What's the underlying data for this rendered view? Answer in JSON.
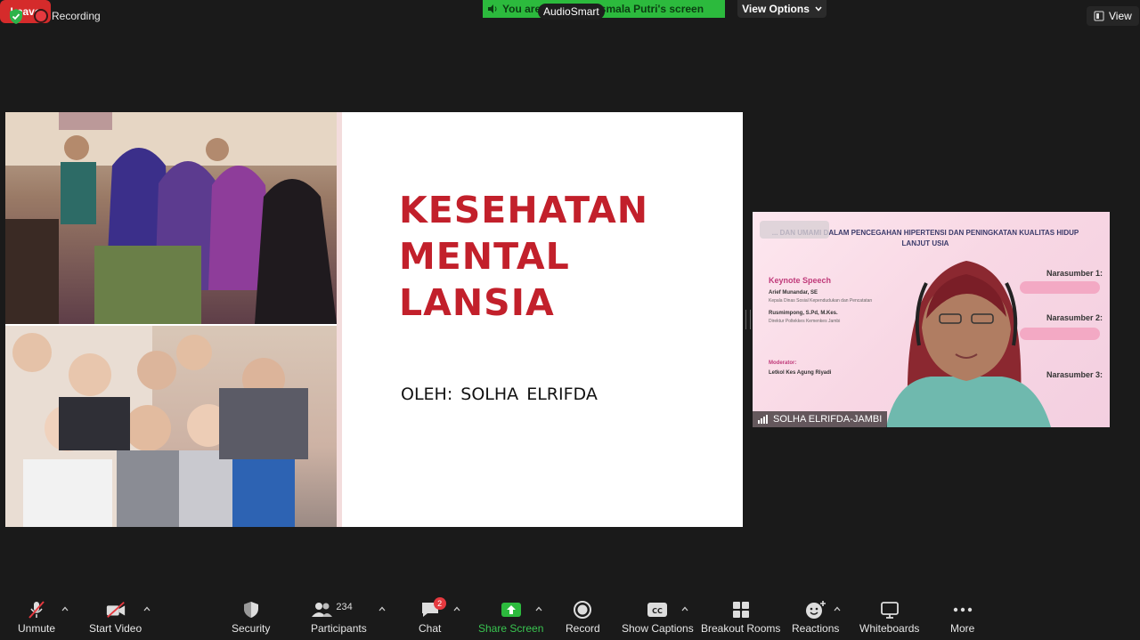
{
  "top_bar": {
    "recording_label": "Recording",
    "share_banner_text": "You are viewing Rosmala Putri's screen",
    "share_overlay_label": "AudioSmart",
    "view_options_label": "View Options",
    "view_label": "View"
  },
  "slide": {
    "title": "KESEHATAN\nMENTAL\nLANSIA",
    "author_line": "OLEH:  SOLHA ELRIFDA"
  },
  "video": {
    "participant_name": "SOLHA ELRIFDA-JAMBI",
    "poster": {
      "heading": "... DAN UMAMI DALAM PENCEGAHAN HIPERTENSI DAN PENINGKATAN KUALITAS HIDUP LANJUT USIA",
      "keynote_title": "Keynote Speech",
      "keynote_1_name": "Arief Munandar, SE",
      "keynote_1_role": "Kepala Dinas Sosial Kependudukan dan Pencatatan",
      "keynote_2_name": "Rusmimpong, S.Pd, M.Kes.",
      "keynote_2_role": "Direktur Poltekkes Kemenkes Jambi",
      "moderator_title": "Moderator:",
      "moderator_name": "Letkol Kes Agung Riyadi",
      "narasumber_1": "Narasumber 1:",
      "narasumber_2": "Narasumber 2:",
      "narasumber_3": "Narasumber 3:"
    }
  },
  "toolbar": {
    "unmute": "Unmute",
    "start_video": "Start Video",
    "security": "Security",
    "participants": "Participants",
    "participants_count": "234",
    "chat": "Chat",
    "chat_badge": "2",
    "share_screen": "Share Screen",
    "record": "Record",
    "show_captions": "Show Captions",
    "breakout_rooms": "Breakout Rooms",
    "reactions": "Reactions",
    "whiteboards": "Whiteboards",
    "more": "More",
    "leave": "Leave"
  },
  "colors": {
    "share_green": "#2cba3d",
    "leave_red": "#d52b2b",
    "title_red": "#c2202b"
  }
}
